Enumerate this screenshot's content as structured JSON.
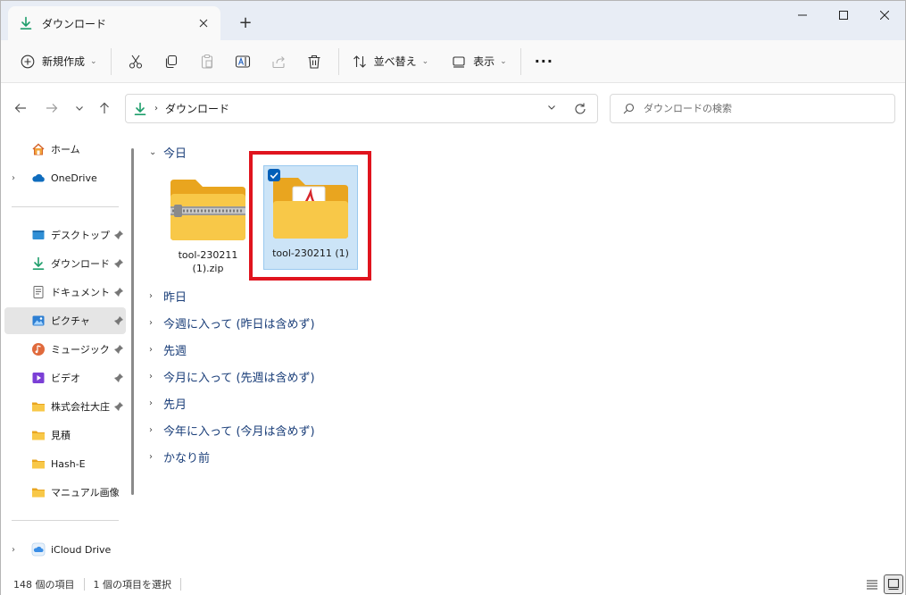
{
  "window": {
    "tab_title": "ダウンロード",
    "new_tab": "+"
  },
  "toolbar": {
    "new_label": "新規作成",
    "sort_label": "並べ替え",
    "view_label": "表示",
    "more": "···"
  },
  "address": {
    "crumb": "ダウンロード",
    "search_placeholder": "ダウンロードの検索"
  },
  "sidebar": {
    "items": [
      {
        "label": "ホーム",
        "icon": "home-icon"
      },
      {
        "label": "OneDrive",
        "icon": "cloud-icon"
      },
      {
        "label": "デスクトップ",
        "icon": "desktop-icon"
      },
      {
        "label": "ダウンロード",
        "icon": "download-icon"
      },
      {
        "label": "ドキュメント",
        "icon": "document-icon"
      },
      {
        "label": "ピクチャ",
        "icon": "pictures-icon"
      },
      {
        "label": "ミュージック",
        "icon": "music-icon"
      },
      {
        "label": "ビデオ",
        "icon": "video-icon"
      },
      {
        "label": "株式会社大庄",
        "icon": "folder-icon"
      },
      {
        "label": "見積",
        "icon": "folder-icon"
      },
      {
        "label": "Hash-E",
        "icon": "folder-icon"
      },
      {
        "label": "マニュアル画像",
        "icon": "folder-icon"
      },
      {
        "label": "iCloud Drive",
        "icon": "icloud-icon"
      }
    ]
  },
  "content": {
    "groups": [
      {
        "label": "今日",
        "expanded": true
      },
      {
        "label": "昨日"
      },
      {
        "label": "今週に入って (昨日は含めず)"
      },
      {
        "label": "先週"
      },
      {
        "label": "今月に入って (先週は含めず)"
      },
      {
        "label": "先月"
      },
      {
        "label": "今年に入って (今月は含めず)"
      },
      {
        "label": "かなり前"
      }
    ],
    "files": [
      {
        "name": "tool-230211 (1).zip",
        "type": "zip-folder"
      },
      {
        "name": "tool-230211 (1)",
        "type": "folder-pdf",
        "selected": true
      }
    ]
  },
  "status": {
    "count": "148 個の項目",
    "selected": "1 個の項目を選択"
  },
  "colors": {
    "accent": "#005fb8",
    "highlight": "#e0141e",
    "folder": "#f8c848",
    "group_text": "#1a3e79",
    "download_green": "#1e9e6b"
  }
}
